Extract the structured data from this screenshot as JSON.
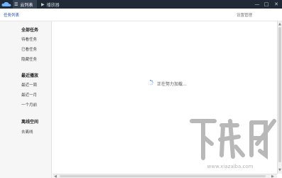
{
  "tabs": [
    {
      "label": "云列表",
      "icon": "list-icon"
    },
    {
      "label": "播放器",
      "icon": "play-icon"
    }
  ],
  "window_controls": {
    "minimize": "—",
    "maximize": "□",
    "close": "✕"
  },
  "toolbar": {
    "breadcrumb": "任务列表",
    "settings_link": "设置管理"
  },
  "sidebar": {
    "sections": [
      {
        "title": "全部任务",
        "items": [
          "待看任务",
          "已看任务",
          "隐藏任务"
        ]
      },
      {
        "title": "最近播放",
        "items": [
          "最近一周",
          "最近一月",
          "一个月前"
        ]
      },
      {
        "title": "离线空间",
        "items": [
          "去离线"
        ]
      }
    ]
  },
  "main": {
    "loading_text": "正在努力加载..."
  },
  "watermark": {
    "text": "下载吧",
    "url": "www.xiazaiba.com"
  },
  "colors": {
    "titlebar": "#1f2a36",
    "accent": "#1f4aa8",
    "sidebar_bg": "#f6f6f6"
  }
}
